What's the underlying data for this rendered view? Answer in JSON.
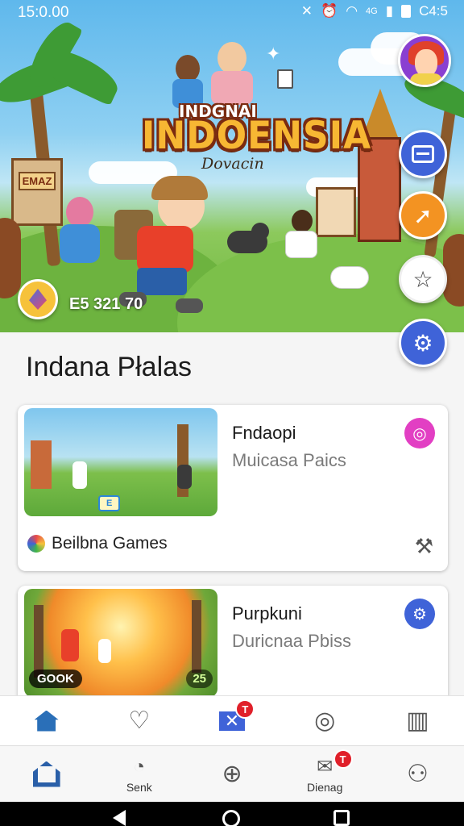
{
  "status_bar": {
    "time": "15:0.00",
    "battery_text": "C4:5",
    "signal_text": "4G"
  },
  "hero": {
    "title_top": "INDGNAI",
    "title_main": "INDOENSIA",
    "title_sub": "Dovacin",
    "sign_text": "EMAZ",
    "count_text": "E5 321 70"
  },
  "section": {
    "title": "Indana Płalas"
  },
  "cards": [
    {
      "title": "Fndaopi",
      "subtitle": "Muicasa Paics",
      "publisher": "Beilbna Games",
      "thumb_label": "E"
    },
    {
      "title": "Purpkuni",
      "subtitle": "Duricnaa Pbiss",
      "thumb_left_pill": "GOOK",
      "thumb_right_pill": "25"
    }
  ],
  "top_tabs": [
    {
      "name": "home",
      "icon": "home-icon",
      "badge": ""
    },
    {
      "name": "favorites",
      "icon": "heart-icon",
      "badge": ""
    },
    {
      "name": "messages",
      "icon": "envelope-icon",
      "badge": "T"
    },
    {
      "name": "search",
      "icon": "search-icon",
      "badge": ""
    },
    {
      "name": "library",
      "icon": "columns-icon",
      "badge": ""
    }
  ],
  "bottom_tabs": [
    {
      "label": "",
      "icon": "home-icon"
    },
    {
      "label": "Senk",
      "icon": "cat-icon"
    },
    {
      "label": "",
      "icon": "plus-circle-icon"
    },
    {
      "label": "Dienag",
      "icon": "mail-icon",
      "badge": "T"
    },
    {
      "label": "",
      "icon": "person-icon"
    }
  ],
  "colors": {
    "accent_blue": "#3f63d8",
    "accent_orange": "#f39322",
    "badge_magenta": "#e23fc3",
    "notification_red": "#e0202a"
  }
}
